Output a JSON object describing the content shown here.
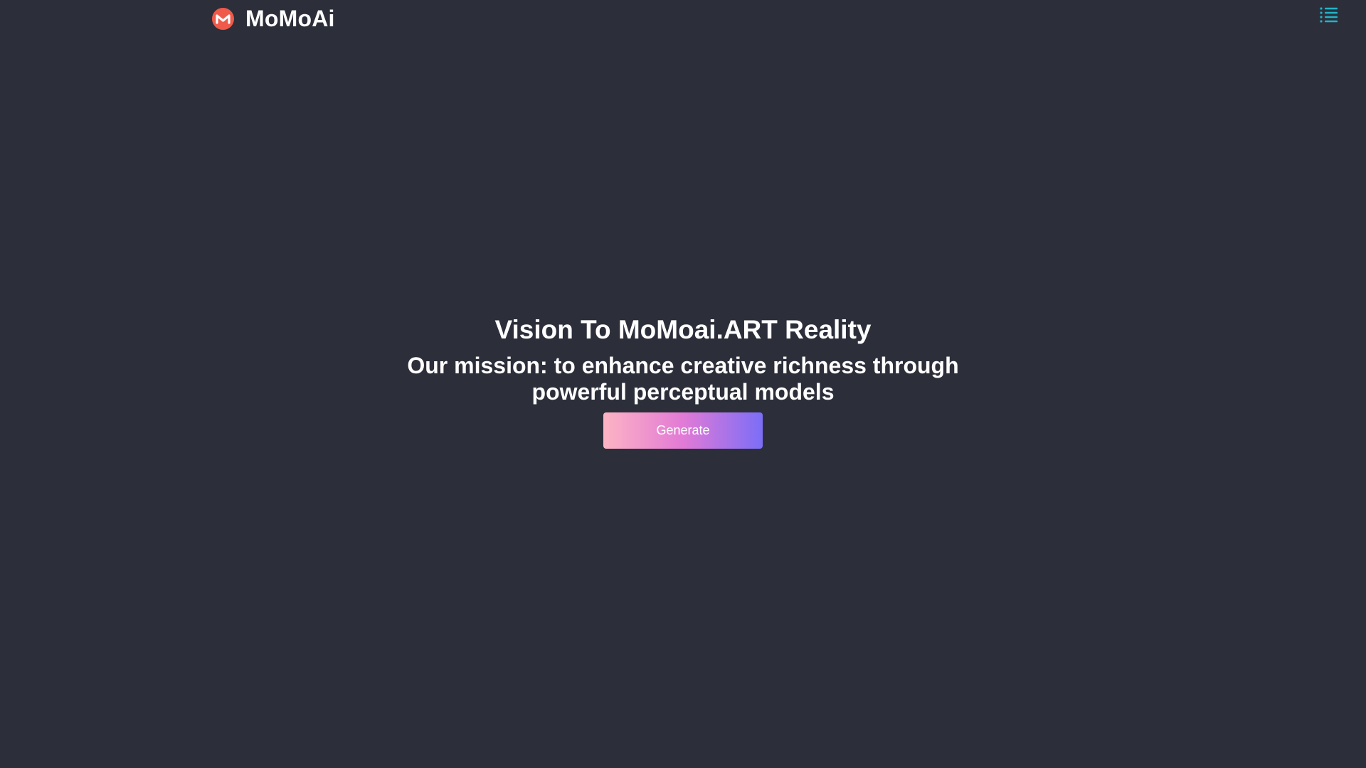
{
  "header": {
    "brand_name": "MoMoAi",
    "logo_icon": "monero-m-logo-icon",
    "logo_color": "#f05a4a",
    "menu_icon": "list-menu-icon",
    "menu_color": "#1fb5c9"
  },
  "hero": {
    "title": "Vision To MoMoai.ART Reality",
    "subtitle": "Our mission: to enhance creative richness through powerful perceptual models",
    "generate_label": "Generate"
  },
  "colors": {
    "background": "#2c2f3a",
    "button_gradient_start": "#fdb4c4",
    "button_gradient_end": "#7b6ef7"
  }
}
